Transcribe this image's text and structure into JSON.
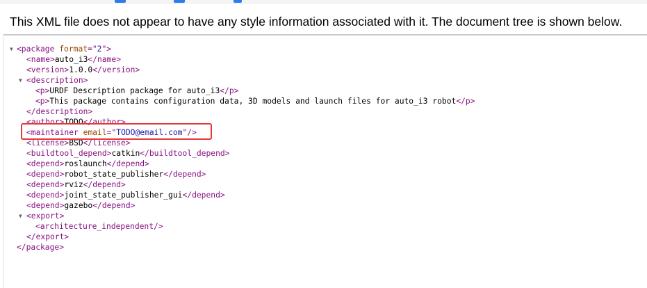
{
  "header": {
    "message": "This XML file does not appear to have any style information associated with it. The document tree is shown below."
  },
  "toggle_glyph": "▼",
  "tree": {
    "package_open": "<package",
    "package_attr": "format",
    "package_eq": "=\"",
    "package_val": "2",
    "package_close": "\">",
    "name_open": "<name>",
    "name_text": "auto_i3",
    "name_close": "</name>",
    "version_open": "<version>",
    "version_text": "1.0.0",
    "version_close": "</version>",
    "description_open": "<description>",
    "p_open": "<p>",
    "p_close": "</p>",
    "p1_text": "URDF Description package for auto_i3",
    "p2_text": "This package contains configuration data, 3D models and launch files for auto_i3 robot",
    "description_close": "</description>",
    "author_open": "<author>",
    "author_text": "TODO",
    "author_close": "</author>",
    "maintainer_open": "<maintainer",
    "maintainer_attr": "email",
    "maintainer_eq": "=\"",
    "maintainer_val": "TODO@email.com",
    "maintainer_close": "\"/>",
    "license_open": "<license>",
    "license_text": "BSD",
    "license_close": "</license>",
    "buildtool_open": "<buildtool_depend>",
    "buildtool_text": "catkin",
    "buildtool_close": "</buildtool_depend>",
    "depend_open": "<depend>",
    "depend_close": "</depend>",
    "depends": [
      "roslaunch",
      "robot_state_publisher",
      "rviz",
      "joint_state_publisher_gui",
      "gazebo"
    ],
    "export_open": "<export>",
    "arch_tag": "<architecture_independent/>",
    "export_close": "</export>",
    "package_end": "</package>"
  },
  "colors": {
    "tag": "#881280",
    "attr": "#994500",
    "value": "#1a1aa6",
    "highlight": "#e53935"
  }
}
